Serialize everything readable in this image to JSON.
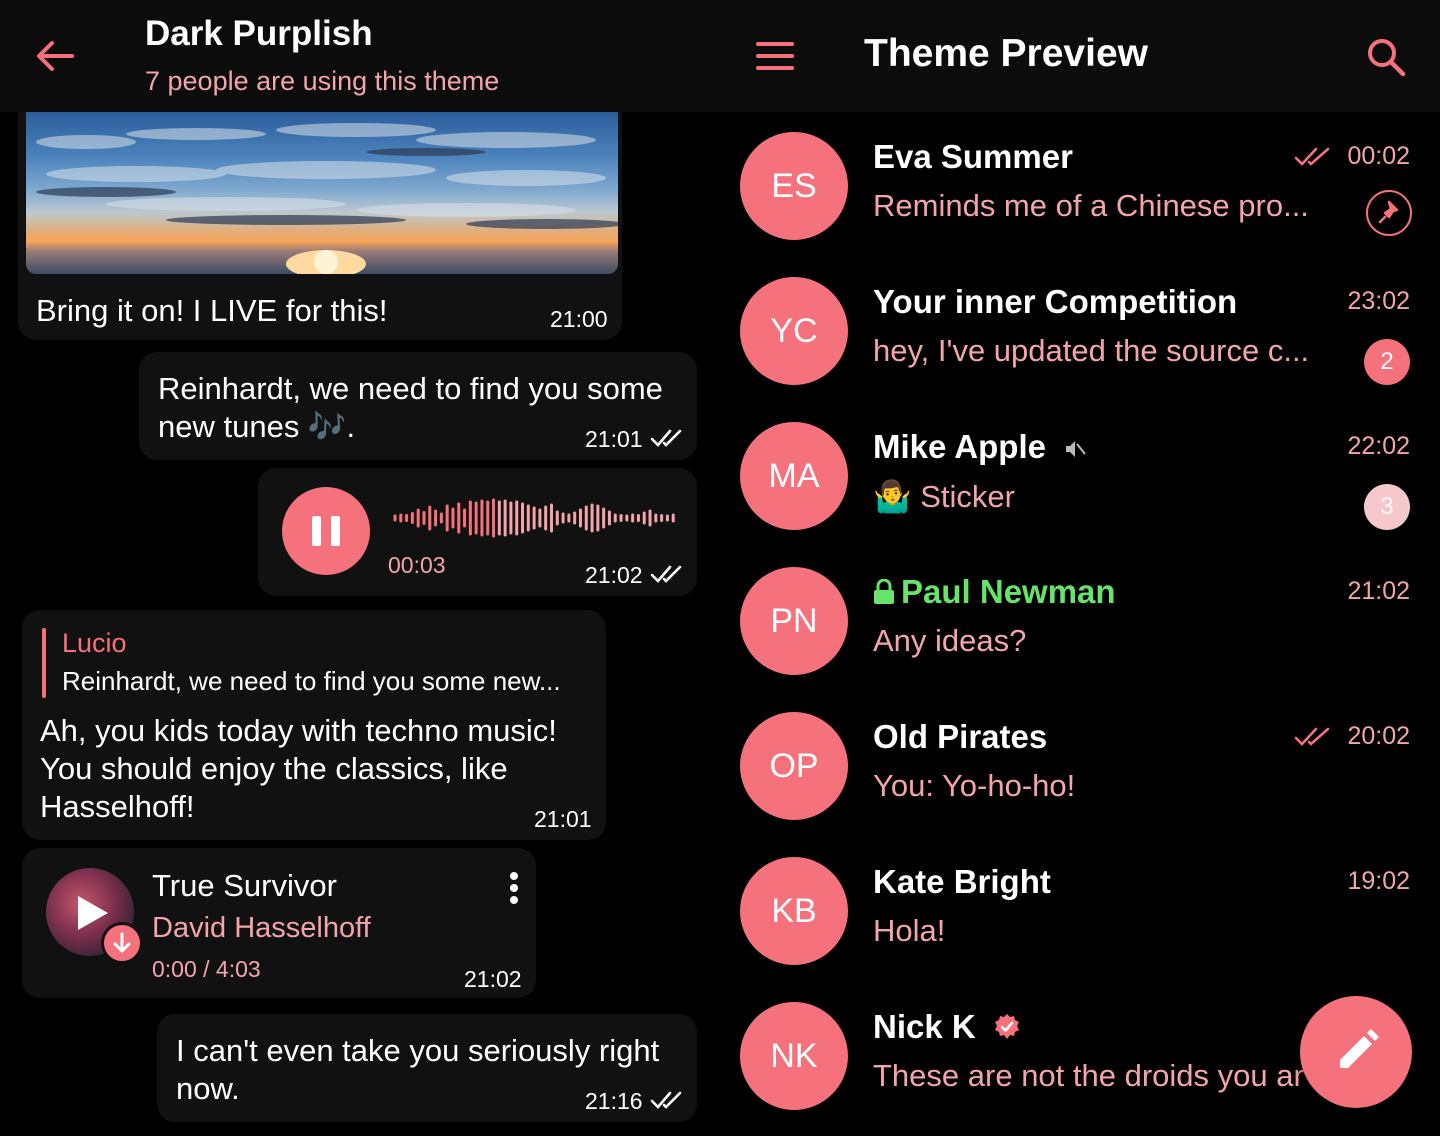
{
  "theme": {
    "accent": "#f5727c",
    "accent_soft": "#f4a5ab",
    "secure_green": "#67e26a",
    "bubble_bg": "#111111",
    "background": "#000000"
  },
  "chat_header": {
    "back_icon": "arrow-left-icon",
    "title": "Dark Purplish",
    "subtitle": "7 people are using this theme"
  },
  "messages": {
    "photo_msg": {
      "text": "Bring it on! I LIVE for this!",
      "time": "21:00"
    },
    "out_tunes": {
      "line1": "Reinhardt, we need to find you some",
      "line2": "new tunes 🎶.",
      "time": "21:01"
    },
    "voice": {
      "duration": "00:03",
      "time": "21:02",
      "icon": "pause-icon"
    },
    "reply_msg": {
      "reply_name": "Lucio",
      "reply_text": "Reinhardt, we need to find you some new...",
      "line1": "Ah, you kids today with techno music!",
      "line2": "You should enjoy the classics, like",
      "line3": "Hasselhoff!",
      "time": "21:01"
    },
    "music": {
      "title": "True Survivor",
      "artist": "David Hasselhoff",
      "progress": "0:00 / 4:03",
      "time": "21:02"
    },
    "out_last": {
      "line1": "I can't even take you seriously right",
      "line2": "now.",
      "time": "21:16"
    }
  },
  "list_header": {
    "menu_icon": "hamburger-menu-icon",
    "title": "Theme Preview",
    "search_icon": "search-icon"
  },
  "chats": [
    {
      "initials": "ES",
      "name": "Eva Summer",
      "preview": "Reminds me of a Chinese pro...",
      "time": "00:02",
      "read": true,
      "pinned": true
    },
    {
      "initials": "YC",
      "name": "Your inner Competition",
      "preview": "hey, I've updated the source c...",
      "time": "23:02",
      "badge": "2"
    },
    {
      "initials": "MA",
      "name": "Mike Apple",
      "preview": "🤷‍♂️ Sticker",
      "time": "22:02",
      "badge": "3",
      "muted": true
    },
    {
      "initials": "PN",
      "name": "Paul Newman",
      "preview": "Any ideas?",
      "time": "21:02",
      "secret": true
    },
    {
      "initials": "OP",
      "name": "Old Pirates",
      "preview": "You: Yo-ho-ho!",
      "time": "20:02",
      "read": true
    },
    {
      "initials": "KB",
      "name": "Kate Bright",
      "preview": "Hola!",
      "time": "19:02"
    },
    {
      "initials": "NK",
      "name": "Nick K",
      "preview": "These are not the droids you ar",
      "time": "",
      "verified": true
    }
  ],
  "fab": {
    "icon": "pencil-icon"
  }
}
